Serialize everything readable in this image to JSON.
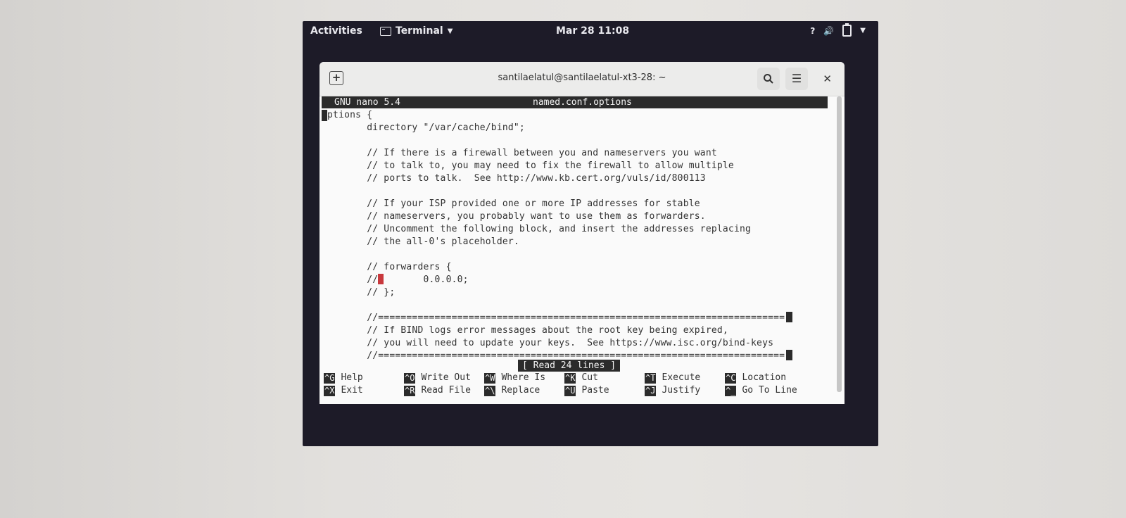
{
  "topbar": {
    "activities": "Activities",
    "app_name": "Terminal",
    "clock": "Mar 28  11:08",
    "tray_help": "?",
    "tray_volume": "🔊"
  },
  "window": {
    "title": "santilaelatul@santilaelatul-xt3-28: ~"
  },
  "nano": {
    "version": "GNU nano 5.4",
    "filename": "named.conf.options",
    "status": "[ Read 24 lines ]",
    "lines": [
      "ptions {",
      "        directory \"/var/cache/bind\";",
      "",
      "        // If there is a firewall between you and nameservers you want",
      "        // to talk to, you may need to fix the firewall to allow multiple",
      "        // ports to talk.  See http://www.kb.cert.org/vuls/id/800113",
      "",
      "        // If your ISP provided one or more IP addresses for stable",
      "        // nameservers, you probably want to use them as forwarders.",
      "        // Uncomment the following block, and insert the addresses replacing",
      "        // the all-0's placeholder.",
      "",
      "        // forwarders {",
      "        //",
      "        // };",
      "",
      "        //========================================================================",
      "        // If BIND logs error messages about the root key being expired,",
      "        // you will need to update your keys.  See https://www.isc.org/bind-keys",
      "        //========================================================================"
    ],
    "forwarder_ip": "       0.0.0.0;",
    "shortcuts_row1": [
      {
        "key": "^G",
        "label": "Help"
      },
      {
        "key": "^O",
        "label": "Write Out"
      },
      {
        "key": "^W",
        "label": "Where Is"
      },
      {
        "key": "^K",
        "label": "Cut"
      },
      {
        "key": "^T",
        "label": "Execute"
      },
      {
        "key": "^C",
        "label": "Location"
      }
    ],
    "shortcuts_row2": [
      {
        "key": "^X",
        "label": "Exit"
      },
      {
        "key": "^R",
        "label": "Read File"
      },
      {
        "key": "^\\",
        "label": "Replace"
      },
      {
        "key": "^U",
        "label": "Paste"
      },
      {
        "key": "^J",
        "label": "Justify"
      },
      {
        "key": "^_",
        "label": "Go To Line"
      }
    ]
  }
}
